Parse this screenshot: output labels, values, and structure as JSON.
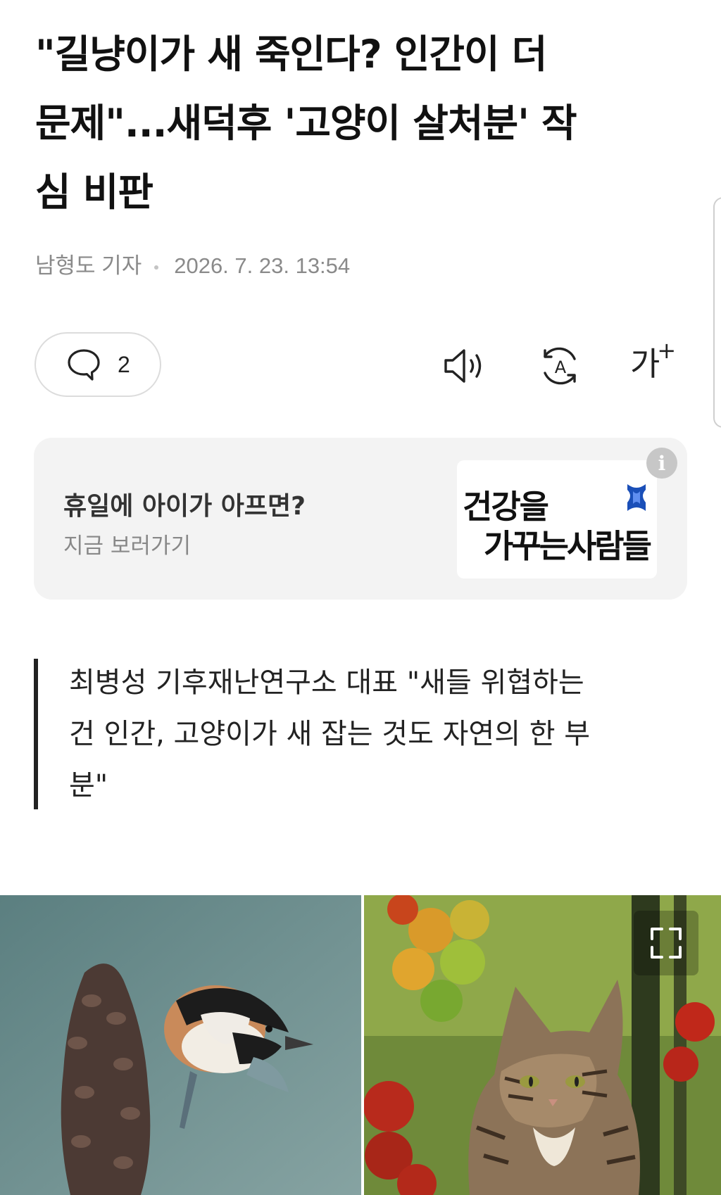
{
  "article": {
    "headline_lines": [
      "\"길냥이가 새 죽인다? 인간이 더",
      "문제\"...새덕후 '고양이 살처분' 작",
      "심 비판"
    ],
    "reporter": "남형도 기자",
    "datetime": "2026. 7. 23. 13:54"
  },
  "toolbar": {
    "comment_count": "2",
    "font_size_label": "가",
    "font_size_plus": "+"
  },
  "ad": {
    "title": "휴일에 아이가 아프면?",
    "subtitle": "지금 보러가기",
    "logo_line1": "건강을",
    "logo_line2": "가꾸는사람들",
    "info_label": "i"
  },
  "summary": {
    "lines": [
      "최병성 기후재난연구소 대표 \"새들 위협하는",
      "건 인간, 고양이가 새 잡는 것도 자연의 한 부",
      "분\""
    ]
  },
  "icons": {
    "comment": "speech-bubble-icon",
    "tts": "speaker-icon",
    "translate": "translate-icon",
    "font": "font-size-icon",
    "expand": "expand-icon",
    "info": "info-icon"
  }
}
